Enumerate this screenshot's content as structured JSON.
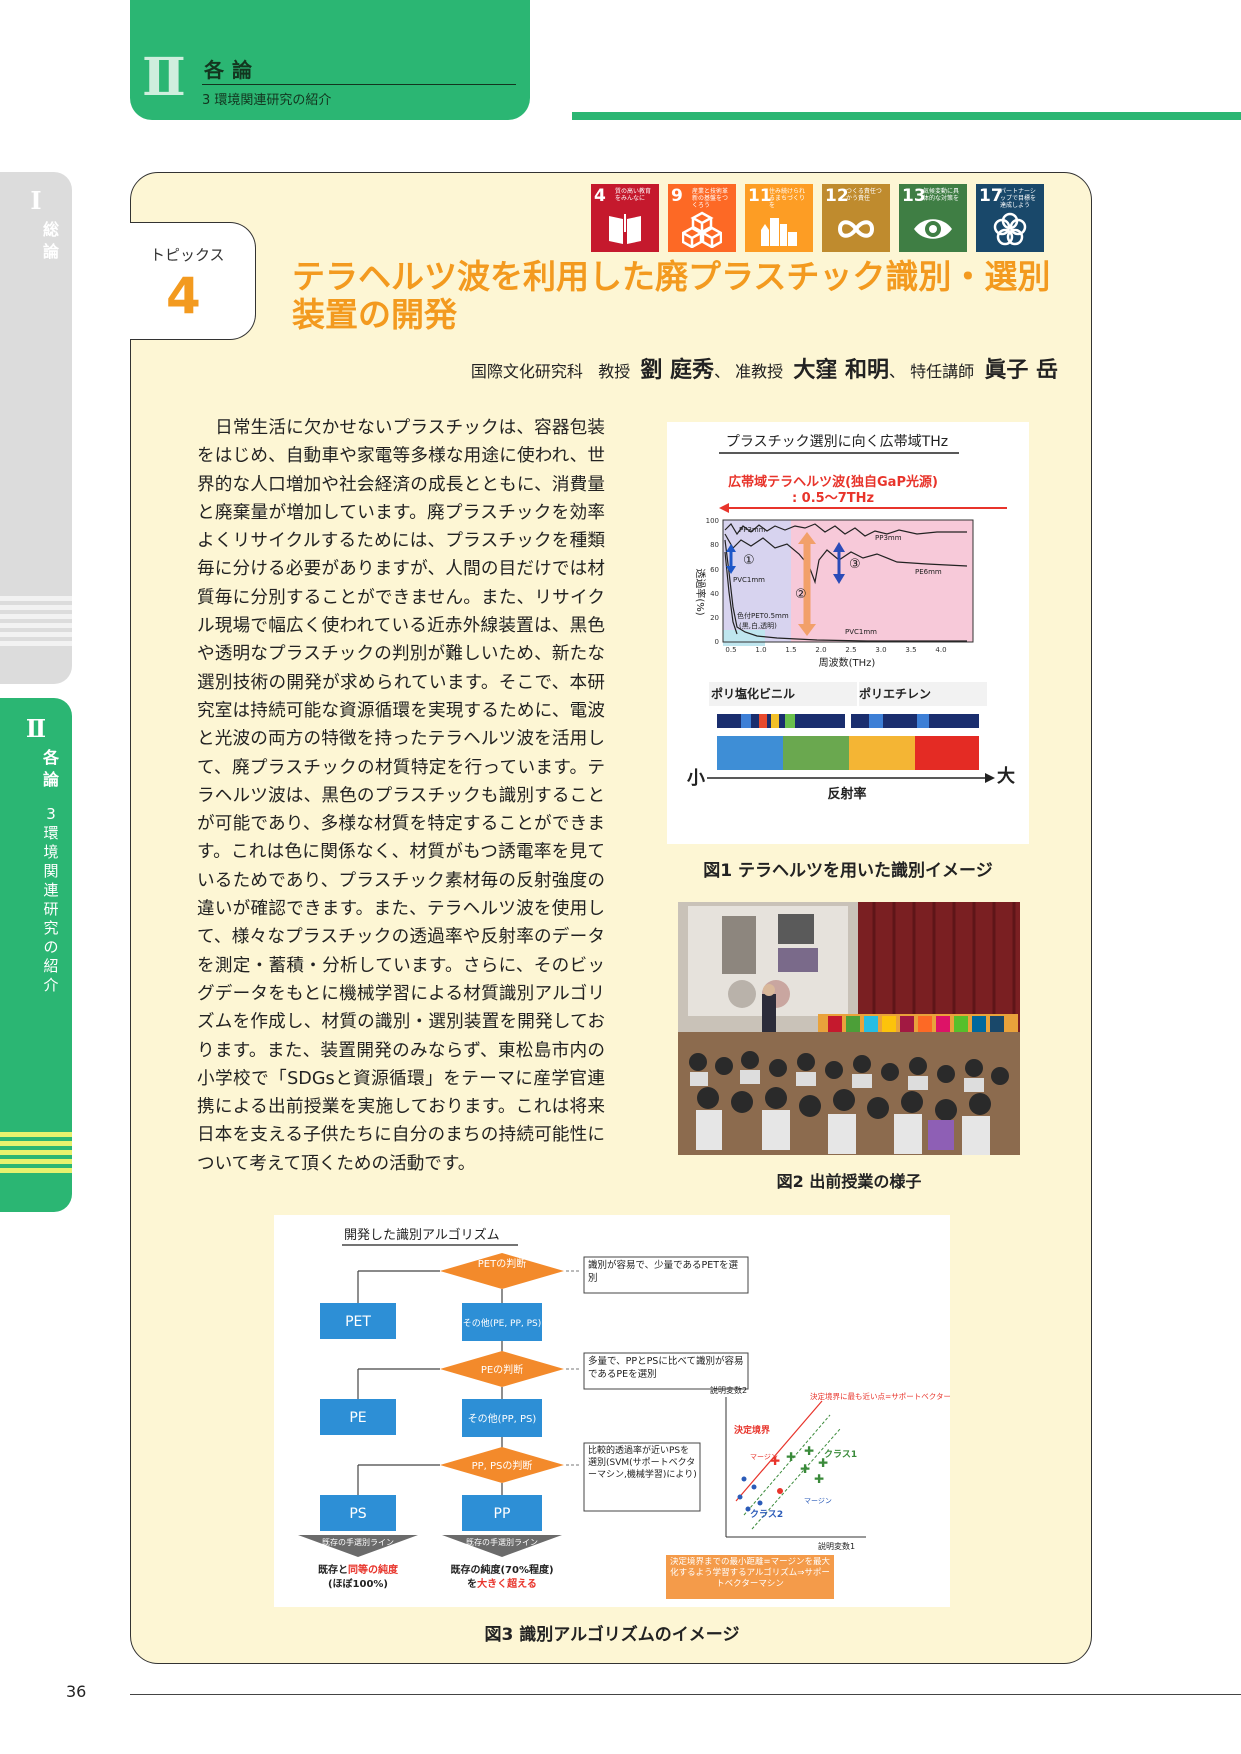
{
  "header": {
    "roman": "Ⅱ",
    "title": "各論",
    "subtitle": "3 環境関連研究の紹介"
  },
  "side_tabs": {
    "tab1": {
      "roman": "Ⅰ",
      "label": "総論"
    },
    "tab2": {
      "roman": "Ⅱ",
      "label": "各論",
      "sub": "3 環境関連研究の紹介"
    }
  },
  "topic": {
    "label": "トピックス",
    "number": "4"
  },
  "title": "テラヘルツ波を利用した廃プラスチック識別・選別装置の開発",
  "authors": {
    "org": "国際文化研究科",
    "a1_role": "教授",
    "a1_name": "劉 庭秀",
    "a2_role": "准教授",
    "a2_name": "大窪 和明",
    "a3_role": "特任講師",
    "a3_name": "眞子 岳"
  },
  "sdgs": [
    {
      "num": "4",
      "text": "質の高い教育をみんなに",
      "color": "#c5192d",
      "icon": "book-icon"
    },
    {
      "num": "9",
      "text": "産業と技術革新の基盤をつくろう",
      "color": "#fd6925",
      "icon": "cubes-icon"
    },
    {
      "num": "11",
      "text": "住み続けられるまちづくりを",
      "color": "#fd9d24",
      "icon": "city-icon"
    },
    {
      "num": "12",
      "text": "つくる責任つかう責任",
      "color": "#bf8b2e",
      "icon": "infinity-icon"
    },
    {
      "num": "13",
      "text": "気候変動に具体的な対策を",
      "color": "#3f7e44",
      "icon": "eye-globe-icon"
    },
    {
      "num": "17",
      "text": "パートナーシップで目標を達成しよう",
      "color": "#19486a",
      "icon": "flower-icon"
    }
  ],
  "body_text": "日常生活に欠かせないプラスチックは、容器包装をはじめ、自動車や家電等多様な用途に使われ、世界的な人口増加や社会経済の成長とともに、消費量と廃棄量が増加しています。廃プラスチックを効率よくリサイクルするためには、プラスチックを種類毎に分ける必要がありますが、人間の目だけでは材質毎に分別することができません。また、リサイクル現場で幅広く使われている近赤外線装置は、黒色や透明なプラスチックの判別が難しいため、新たな選別技術の開発が求められています。そこで、本研究室は持続可能な資源循環を実現するために、電波と光波の両方の特徴を持ったテラヘルツ波を活用して、廃プラスチックの材質特定を行っています。テラヘルツ波は、黒色のプラスチックも識別することが可能であり、多様な材質を特定することができます。これは色に関係なく、材質がもつ誘電率を見ているためであり、プラスチック素材毎の反射強度の違いが確認できます。また、テラヘルツ波を使用して、様々なプラスチックの透過率や反射率のデータを測定・蓄積・分析しています。さらに、そのビッグデータをもとに機械学習による材質識別アルゴリズムを作成し、材質の識別・選別装置を開発しております。また、装置開発のみならず、東松島市内の小学校で「SDGsと資源循環」をテーマに産学官連携による出前授業を実施しております。これは将来日本を支える子供たちに自分のまちの持続可能性について考えて頂くための活動です。",
  "fig1": {
    "heading": "プラスチック選別に向く広帯域THz",
    "band_label_1": "広帯域テラヘルツ波(独自GaP光源)",
    "band_label_2": ": 0.5〜7THz",
    "ylabel": "透過率(%)",
    "xlabel": "周波数(THz)",
    "yticks": [
      "100",
      "80",
      "60",
      "40",
      "20",
      "0"
    ],
    "xticks": [
      "0.5",
      "1.0",
      "1.5",
      "2.0",
      "2.5",
      "3.0",
      "3.5",
      "4.0"
    ],
    "curve_labels": [
      "PP3mm",
      "PP3mm",
      "PE6mm",
      "PVC1mm",
      "色付PET0.5mm",
      "(黒,白,透明)",
      "PVC1mm"
    ],
    "markers": [
      "①",
      "②",
      "③"
    ],
    "material_1": "ポリ塩化ビニル",
    "material_2": "ポリエチレン",
    "scale_small": "小",
    "scale_large": "大",
    "scale_label": "反射率"
  },
  "fig1_caption": "図1 テラヘルツを用いた識別イメージ",
  "fig2_caption": "図2 出前授業の様子",
  "fig3": {
    "heading": "開発した識別アルゴリズム",
    "d1": "PETの判断",
    "d2": "PEの判断",
    "d3": "PP, PSの判断",
    "pet": "PET",
    "other1": "その他(PE, PP, PS)",
    "pe": "PE",
    "other2": "その他(PP, PS)",
    "ps": "PS",
    "pp": "PP",
    "note1": "識別が容易で、少量であるPETを選別",
    "note2": "多量で、PPとPSに比べて識別が容易であるPEを選別",
    "note3": "比較的透過率が近いPSを選別(SVM(サポートベクターマシン,機械学習)により)",
    "arrow1": "既存の手選別ライン",
    "arrow2": "既存の手選別ライン",
    "result1a": "既存と",
    "result1b": "同等の純度",
    "result1c": "(ほぼ100%)",
    "result2a": "既存の純度(70%程度)",
    "result2b": "を",
    "result2c": "大きく超える",
    "svm_y": "説明変数2",
    "svm_x": "説明変数1",
    "svm_boundary": "決定境界",
    "svm_sv": "決定境界に最も近い点=サポートベクター",
    "svm_margin": "マージン",
    "svm_class1": "クラス1",
    "svm_class2": "クラス2",
    "svm_box": "決定境界までの最小距離=マージンを最大化するよう学習するアルゴリズム⇒サポートベクターマシン"
  },
  "fig3_caption": "図3 識別アルゴリズムのイメージ",
  "page_number": "36"
}
